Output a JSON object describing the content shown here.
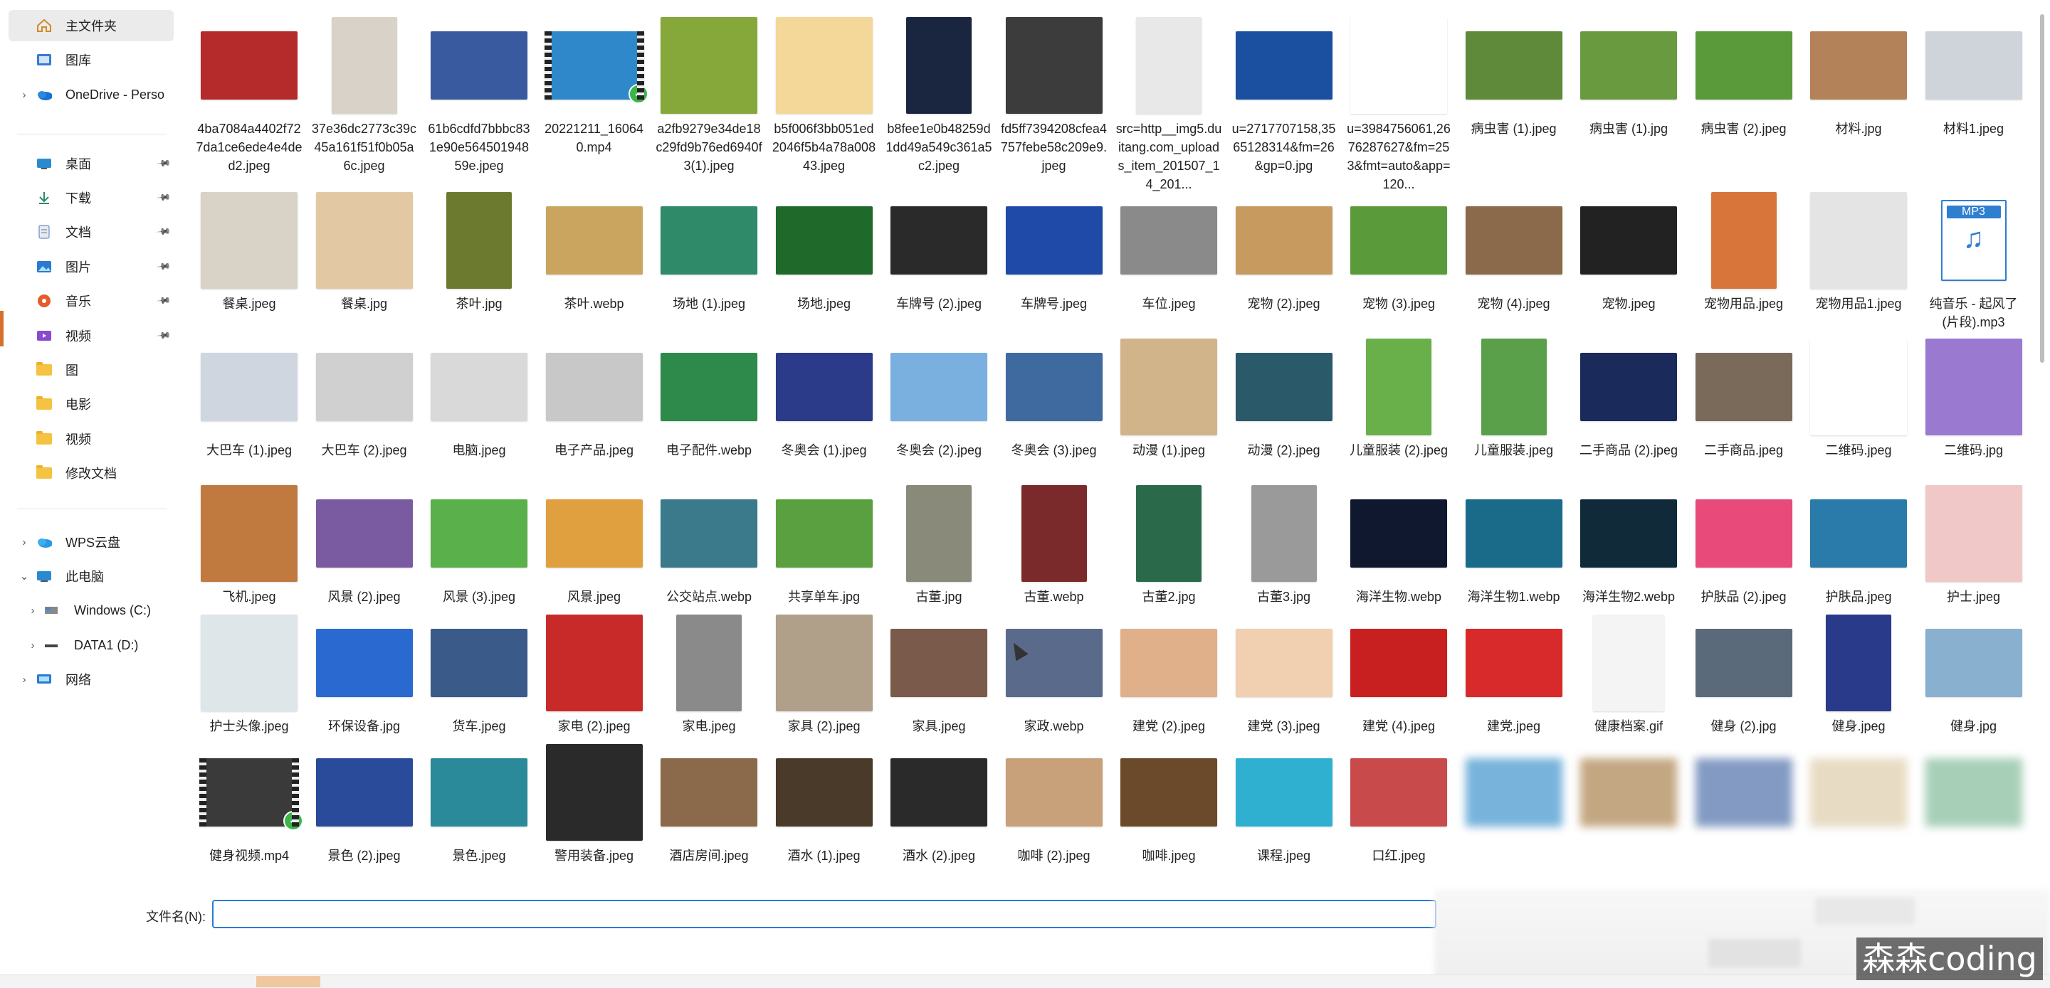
{
  "sidebar": {
    "items": [
      {
        "label": "主文件夹",
        "icon": "home-icon"
      },
      {
        "label": "图库",
        "icon": "gallery-icon"
      },
      {
        "label": "OneDrive - Perso",
        "icon": "onedrive-icon"
      },
      {
        "label": "桌面",
        "icon": "desktop-icon",
        "pinned": true
      },
      {
        "label": "下载",
        "icon": "download-icon",
        "pinned": true
      },
      {
        "label": "文档",
        "icon": "document-icon",
        "pinned": true
      },
      {
        "label": "图片",
        "icon": "pictures-icon",
        "pinned": true
      },
      {
        "label": "音乐",
        "icon": "music-icon",
        "pinned": true
      },
      {
        "label": "视频",
        "icon": "video-icon",
        "pinned": true
      },
      {
        "label": "图",
        "icon": "folder-icon"
      },
      {
        "label": "电影",
        "icon": "folder-icon"
      },
      {
        "label": "视频",
        "icon": "folder-icon"
      },
      {
        "label": "修改文档",
        "icon": "folder-icon"
      },
      {
        "label": "WPS云盘",
        "icon": "wps-cloud-icon"
      },
      {
        "label": "此电脑",
        "icon": "this-pc-icon"
      },
      {
        "label": "Windows (C:)",
        "icon": "drive-c-icon"
      },
      {
        "label": "DATA1 (D:)",
        "icon": "drive-d-icon"
      },
      {
        "label": "网络",
        "icon": "network-icon"
      }
    ]
  },
  "files": [
    {
      "name": "4ba7084a4402f727da1ce6ede4e4ded2.jpeg",
      "color": "#b52a2a"
    },
    {
      "name": "37e36dc2773c39c45a161f51f0b05a6c.jpeg",
      "color": "#d8d2c8"
    },
    {
      "name": "61b6cdfd7bbbc831e90e56450194859e.jpeg",
      "color": "#3a5aa0"
    },
    {
      "name": "20221211_160640.mp4",
      "color": "#2e88c9"
    },
    {
      "name": "a2fb9279e34de18c29fd9b76ed6940f3(1).jpeg",
      "color": "#86a83a"
    },
    {
      "name": "b5f006f3bb051ed2046f5b4a78a00843.jpeg",
      "color": "#f3d89a"
    },
    {
      "name": "b8fee1e0b48259d1dd49a549c361a5c2.jpeg",
      "color": "#1a2540"
    },
    {
      "name": "fd5ff7394208cfea4757febe58c209e9.jpeg",
      "color": "#3c3c3c"
    },
    {
      "name": "src=http__img5.duitang.com_uploads_item_201507_14_201...",
      "color": "#e8e8e8"
    },
    {
      "name": "u=2717707158,3565128314&fm=26&gp=0.jpg",
      "color": "#1b4fa0"
    },
    {
      "name": "u=3984756061,2676287627&fm=253&fmt=auto&app=120...",
      "color": "#ffffff"
    },
    {
      "name": "病虫害 (1).jpeg",
      "color": "#5e8a3a"
    },
    {
      "name": "病虫害 (1).jpg",
      "color": "#6a9a40"
    },
    {
      "name": "病虫害 (2).jpeg",
      "color": "#5a9a3a"
    },
    {
      "name": "材料.jpg",
      "color": "#b48258"
    },
    {
      "name": "材料1.jpeg",
      "color": "#cfd4da"
    },
    {
      "name": "餐桌.jpeg",
      "color": "#d9d2c6"
    },
    {
      "name": "餐桌.jpg",
      "color": "#e2c9a4"
    },
    {
      "name": "茶叶.jpg",
      "color": "#6c7a30"
    },
    {
      "name": "茶叶.webp",
      "color": "#c9a560"
    },
    {
      "name": "场地 (1).jpeg",
      "color": "#2f8a6a"
    },
    {
      "name": "场地.jpeg",
      "color": "#1f6a2a"
    },
    {
      "name": "车牌号 (2).jpeg",
      "color": "#2a2a2a"
    },
    {
      "name": "车牌号.jpeg",
      "color": "#1f4aa8"
    },
    {
      "name": "车位.jpeg",
      "color": "#8a8a8a"
    },
    {
      "name": "宠物 (2).jpeg",
      "color": "#c79a60"
    },
    {
      "name": "宠物 (3).jpeg",
      "color": "#5a9a3a"
    },
    {
      "name": "宠物 (4).jpeg",
      "color": "#8a6a4a"
    },
    {
      "name": "宠物.jpeg",
      "color": "#222222"
    },
    {
      "name": "宠物用品.jpeg",
      "color": "#d8753a"
    },
    {
      "name": "宠物用品1.jpeg",
      "color": "#e4e4e4"
    },
    {
      "name": "纯音乐 - 起风了 (片段).mp3",
      "color": "#2f7fd0"
    },
    {
      "name": "大巴车 (1).jpeg",
      "color": "#cfd6e0"
    },
    {
      "name": "大巴车 (2).jpeg",
      "color": "#d0d0d0"
    },
    {
      "name": "电脑.jpeg",
      "color": "#d9d9d9"
    },
    {
      "name": "电子产品.jpeg",
      "color": "#c8c8c8"
    },
    {
      "name": "电子配件.webp",
      "color": "#2e8a4a"
    },
    {
      "name": "冬奥会 (1).jpeg",
      "color": "#2c3a8a"
    },
    {
      "name": "冬奥会 (2).jpeg",
      "color": "#7ab0e0"
    },
    {
      "name": "冬奥会 (3).jpeg",
      "color": "#3f6aa0"
    },
    {
      "name": "动漫 (1).jpeg",
      "color": "#d2b48a"
    },
    {
      "name": "动漫 (2).jpeg",
      "color": "#2a5a6a"
    },
    {
      "name": "儿童服装 (2).jpeg",
      "color": "#6ab04a"
    },
    {
      "name": "儿童服装.jpeg",
      "color": "#5aa04a"
    },
    {
      "name": "二手商品 (2).jpeg",
      "color": "#1a2a5a"
    },
    {
      "name": "二手商品.jpeg",
      "color": "#7a6a5a"
    },
    {
      "name": "二维码.jpeg",
      "color": "#ffffff"
    },
    {
      "name": "二维码.jpg",
      "color": "#9a7ad0"
    },
    {
      "name": "飞机.jpeg",
      "color": "#c07a40"
    },
    {
      "name": "风景 (2).jpeg",
      "color": "#7a5aa0"
    },
    {
      "name": "风景 (3).jpeg",
      "color": "#5ab04a"
    },
    {
      "name": "风景.jpeg",
      "color": "#e0a040"
    },
    {
      "name": "公交站点.webp",
      "color": "#3a7a8a"
    },
    {
      "name": "共享单车.jpg",
      "color": "#5aa040"
    },
    {
      "name": "古董.jpg",
      "color": "#8a8a7a"
    },
    {
      "name": "古董.webp",
      "color": "#7a2a2a"
    },
    {
      "name": "古董2.jpg",
      "color": "#2a6a4a"
    },
    {
      "name": "古董3.jpg",
      "color": "#9a9a9a"
    },
    {
      "name": "海洋生物.webp",
      "color": "#101830"
    },
    {
      "name": "海洋生物1.webp",
      "color": "#1a6a8a"
    },
    {
      "name": "海洋生物2.webp",
      "color": "#102a3a"
    },
    {
      "name": "护肤品 (2).jpeg",
      "color": "#e84a7a"
    },
    {
      "name": "护肤品.jpeg",
      "color": "#2a7aaa"
    },
    {
      "name": "护士.jpeg",
      "color": "#f0c8c8"
    },
    {
      "name": "护士头像.jpeg",
      "color": "#dfe6ea"
    },
    {
      "name": "环保设备.jpg",
      "color": "#2a6ad0"
    },
    {
      "name": "货车.jpeg",
      "color": "#3a5a8a"
    },
    {
      "name": "家电 (2).jpeg",
      "color": "#c82a2a"
    },
    {
      "name": "家电.jpeg",
      "color": "#8a8a8a"
    },
    {
      "name": "家具 (2).jpeg",
      "color": "#b0a08a"
    },
    {
      "name": "家具.jpeg",
      "color": "#7a5a4a"
    },
    {
      "name": "家政.webp",
      "color": "#5a6a8a"
    },
    {
      "name": "建党 (2).jpeg",
      "color": "#e0b08a"
    },
    {
      "name": "建党 (3).jpeg",
      "color": "#f0d0b0"
    },
    {
      "name": "建党 (4).jpeg",
      "color": "#c82020"
    },
    {
      "name": "建党.jpeg",
      "color": "#d82a2a"
    },
    {
      "name": "健康档案.gif",
      "color": "#f4f4f4"
    },
    {
      "name": "健身 (2).jpg",
      "color": "#5a6a7a"
    },
    {
      "name": "健身.jpeg",
      "color": "#2a3a8a"
    },
    {
      "name": "健身.jpg",
      "color": "#8ab0d0"
    },
    {
      "name": "健身视频.mp4",
      "color": "#3a3a3a"
    },
    {
      "name": "景色 (2).jpeg",
      "color": "#2a4a9a"
    },
    {
      "name": "景色.jpeg",
      "color": "#2a8a9a"
    },
    {
      "name": "警用装备.jpeg",
      "color": "#2a2a2a"
    },
    {
      "name": "酒店房间.jpeg",
      "color": "#8a6a4a"
    },
    {
      "name": "酒水 (1).jpeg",
      "color": "#4a3a2a"
    },
    {
      "name": "酒水 (2).jpeg",
      "color": "#2a2a2a"
    },
    {
      "name": "咖啡 (2).jpeg",
      "color": "#c8a07a"
    },
    {
      "name": "咖啡.jpeg",
      "color": "#6a4a2a"
    },
    {
      "name": "课程.jpeg",
      "color": "#30b0d0"
    },
    {
      "name": "口红.jpeg",
      "color": "#c84a4a"
    },
    {
      "name": "",
      "color": "#4a9ad0"
    },
    {
      "name": "",
      "color": "#b08a5a"
    },
    {
      "name": "",
      "color": "#5a7ab0"
    },
    {
      "name": "",
      "color": "#e0d0b0"
    },
    {
      "name": "",
      "color": "#8ac0a0"
    }
  ],
  "filename": {
    "label": "文件名(N):",
    "value": ""
  },
  "watermark": "森森coding"
}
